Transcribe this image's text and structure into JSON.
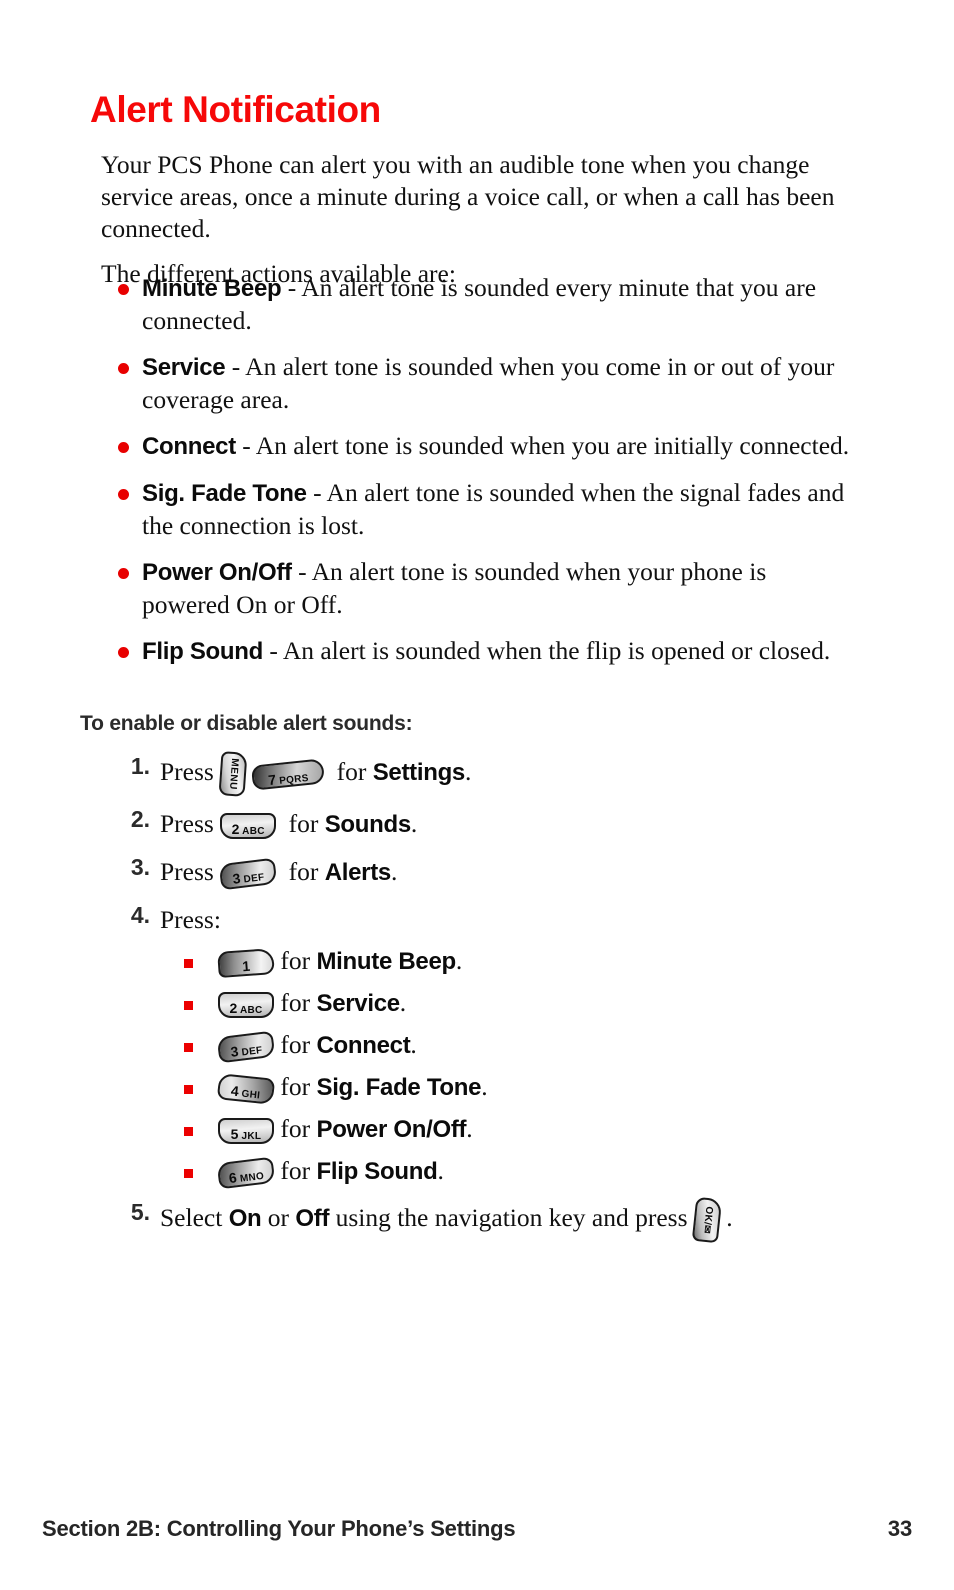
{
  "document": {
    "title": "Alert Notification",
    "title_color": "#f60808",
    "bullet_color": "#e80000",
    "subbullet_color": "#ec0000"
  },
  "intro": {
    "paragraph1": "Your PCS Phone can alert you with an audible tone when you change service areas, once a minute during a voice call, or when a call has been connected.",
    "paragraph2": "The different actions available are:"
  },
  "alert_actions": [
    {
      "term": "Minute Beep",
      "description": " - An alert tone is sounded every minute that you are connected."
    },
    {
      "term": "Service",
      "description": " - An alert tone is sounded when you come in or out of your coverage area."
    },
    {
      "term": "Connect",
      "description": " - An alert tone is sounded when you are initially connected."
    },
    {
      "term": "Sig. Fade Tone",
      "description": " - An alert tone is sounded when the signal fades and the connection is lost."
    },
    {
      "term": "Power On/Off",
      "description": " - An alert tone is sounded when your phone is powered On or Off."
    },
    {
      "term": "Flip Sound",
      "description": " - An alert is sounded when the flip is opened or closed."
    }
  ],
  "procedure": {
    "heading": "To enable or disable alert sounds:",
    "steps": [
      {
        "number": "1.",
        "lead": "Press",
        "keys": [
          {
            "icon": "menu-key-icon",
            "number": "",
            "letters": "MENU",
            "style": "vert"
          },
          {
            "icon": "number-key-7-icon",
            "number": "7",
            "letters": "PQRS",
            "style": "wide7"
          }
        ],
        "mid": "for",
        "target": "Settings",
        "end": "."
      },
      {
        "number": "2.",
        "lead": "Press",
        "keys": [
          {
            "icon": "number-key-2-icon",
            "number": "2",
            "letters": "ABC",
            "style": "flat"
          }
        ],
        "mid": "for",
        "target": "Sounds",
        "end": "."
      },
      {
        "number": "3.",
        "lead": "Press",
        "keys": [
          {
            "icon": "number-key-3-icon",
            "number": "3",
            "letters": "DEF",
            "style": "tiltL"
          }
        ],
        "mid": "for",
        "target": "Alerts",
        "end": "."
      },
      {
        "number": "4.",
        "lead": "Press:",
        "keys": [],
        "mid": "",
        "target": "",
        "end": ""
      },
      {
        "number": "5.",
        "lead": "Select",
        "option_on": "On",
        "conjunction": "or",
        "option_off": "Off",
        "tail": "using the navigation key and press",
        "keys": [
          {
            "icon": "ok-message-key-icon",
            "number": "",
            "letters": "OK/✉",
            "style": "ok"
          }
        ],
        "end": "."
      }
    ],
    "substeps": [
      {
        "key": {
          "icon": "number-key-1-icon",
          "number": "1",
          "letters": "",
          "style": "one"
        },
        "mid": "for",
        "target": "Minute Beep",
        "end": "."
      },
      {
        "key": {
          "icon": "number-key-2-icon",
          "number": "2",
          "letters": "ABC",
          "style": "flat"
        },
        "mid": "for",
        "target": "Service",
        "end": "."
      },
      {
        "key": {
          "icon": "number-key-3-icon",
          "number": "3",
          "letters": "DEF",
          "style": "tiltL"
        },
        "mid": "for",
        "target": "Connect",
        "end": "."
      },
      {
        "key": {
          "icon": "number-key-4-icon",
          "number": "4",
          "letters": "GHI",
          "style": "tiltR"
        },
        "mid": "for",
        "target": "Sig. Fade Tone",
        "end": "."
      },
      {
        "key": {
          "icon": "number-key-5-icon",
          "number": "5",
          "letters": "JKL",
          "style": "flat"
        },
        "mid": "for",
        "target": "Power On/Off",
        "end": "."
      },
      {
        "key": {
          "icon": "number-key-6-icon",
          "number": "6",
          "letters": "MNO",
          "style": "tiltL"
        },
        "mid": "for",
        "target": "Flip Sound",
        "end": "."
      }
    ]
  },
  "footer": {
    "section": "Section 2B: Controlling Your Phone’s Settings",
    "page_number": "33"
  }
}
